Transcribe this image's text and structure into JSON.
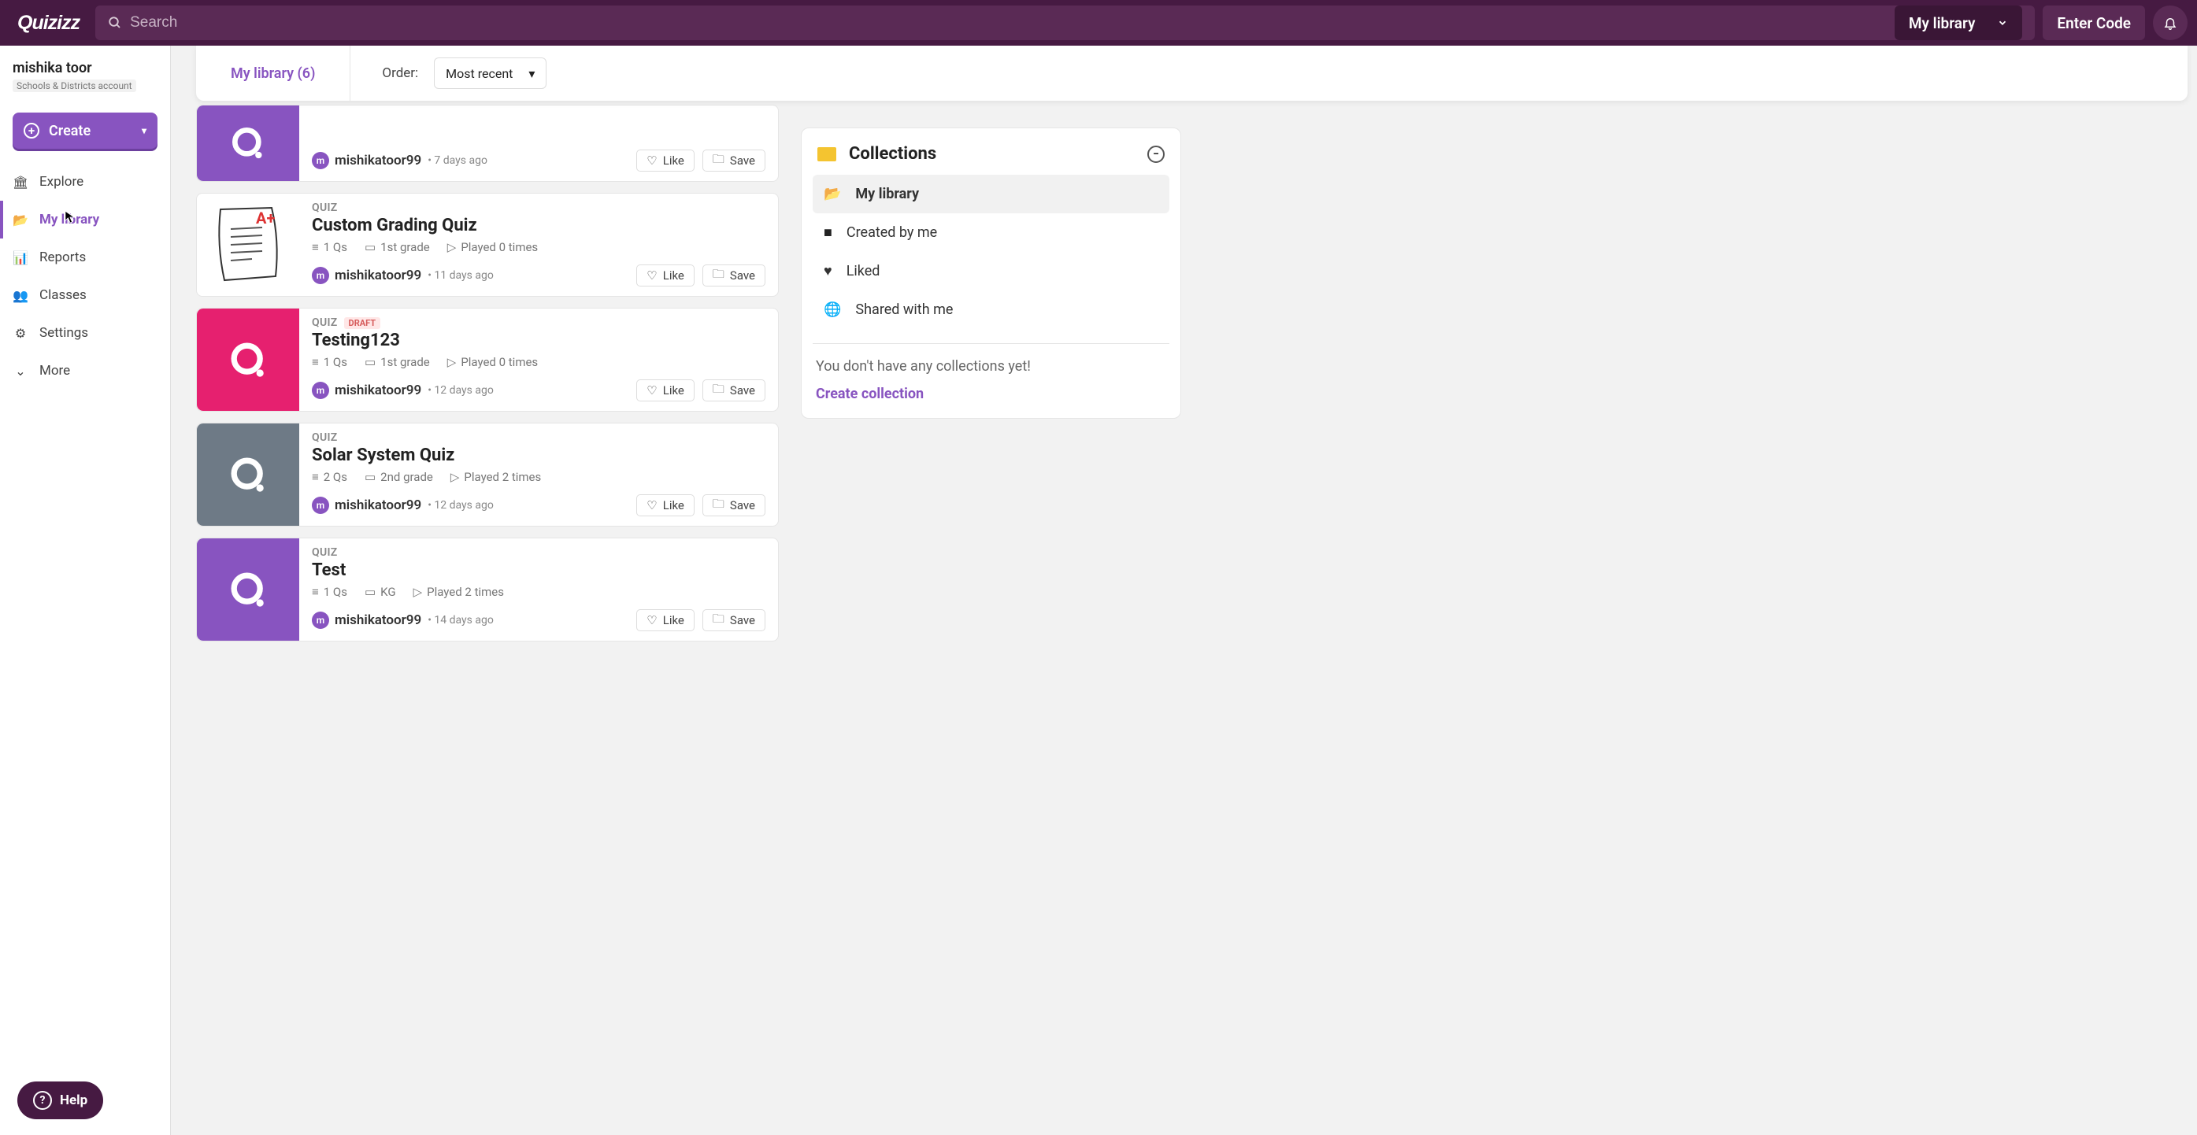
{
  "header": {
    "logo_text": "Quizizz",
    "search_placeholder": "Search",
    "library_selector": "My library",
    "enter_code": "Enter Code"
  },
  "sidebar": {
    "user_name": "mishika toor",
    "user_sub": "Schools & Districts account",
    "create_label": "Create",
    "items": [
      {
        "label": "Explore",
        "icon": "🏛"
      },
      {
        "label": "My library",
        "icon": "📂",
        "active": true
      },
      {
        "label": "Reports",
        "icon": "📊"
      },
      {
        "label": "Classes",
        "icon": "👥"
      },
      {
        "label": "Settings",
        "icon": "⚙"
      },
      {
        "label": "More",
        "icon": "⌄"
      }
    ],
    "help_label": "Help"
  },
  "toolbar": {
    "tab_label": "My library (6)",
    "order_label": "Order:",
    "order_value": "Most recent"
  },
  "cards": [
    {
      "partial": true,
      "thumb_style": "purple",
      "author": "mishikatoor99",
      "ago": "7 days ago",
      "like": "Like",
      "save": "Save"
    },
    {
      "thumb_style": "paper",
      "type": "QUIZ",
      "title": "Custom Grading Quiz",
      "qs": "1 Qs",
      "grade": "1st grade",
      "plays": "Played 0 times",
      "author": "mishikatoor99",
      "ago": "11 days ago",
      "like": "Like",
      "save": "Save"
    },
    {
      "thumb_style": "magenta",
      "type": "QUIZ",
      "draft": "DRAFT",
      "title": "Testing123",
      "qs": "1 Qs",
      "grade": "1st grade",
      "plays": "Played 0 times",
      "author": "mishikatoor99",
      "ago": "12 days ago",
      "like": "Like",
      "save": "Save"
    },
    {
      "thumb_style": "slate",
      "type": "QUIZ",
      "title": "Solar System Quiz",
      "qs": "2 Qs",
      "grade": "2nd grade",
      "plays": "Played 2 times",
      "author": "mishikatoor99",
      "ago": "12 days ago",
      "like": "Like",
      "save": "Save"
    },
    {
      "thumb_style": "purple",
      "type": "QUIZ",
      "title": "Test",
      "qs": "1 Qs",
      "grade": "KG",
      "plays": "Played 2 times",
      "author": "mishikatoor99",
      "ago": "14 days ago",
      "like": "Like",
      "save": "Save"
    }
  ],
  "collections": {
    "title": "Collections",
    "items": [
      {
        "label": "My library",
        "icon": "📂",
        "active": true
      },
      {
        "label": "Created by me",
        "icon": "■"
      },
      {
        "label": "Liked",
        "icon": "♥"
      },
      {
        "label": "Shared with me",
        "icon": "🌐"
      }
    ],
    "empty_text": "You don't have any collections yet!",
    "create_label": "Create collection"
  }
}
